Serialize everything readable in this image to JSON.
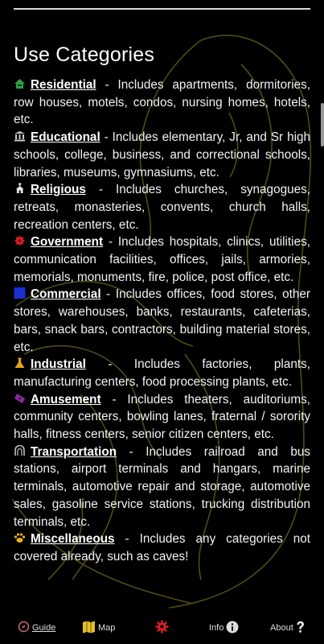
{
  "title": "Use Categories",
  "categories": [
    {
      "icon": "house-icon",
      "name": "Residential",
      "desc": " - Includes apartments, dormitories, row houses, motels, condos, nursing homes, hotels, etc."
    },
    {
      "icon": "school-building-icon",
      "name": "Educational",
      "desc": " - Includes elementary, Jr, and Sr high schools, college, business, and correctional schools, libraries, museums, gymnasiums, etc."
    },
    {
      "icon": "church-icon",
      "name": "Religious",
      "desc": " - Includes churches, synagogues, retreats, monasteries, convents, church halls, recreation centers, etc."
    },
    {
      "icon": "government-badge-icon",
      "name": "Government",
      "desc": " - Includes hospitals, clinics, utilities, communication facilities, offices, jails, armories, memorials, monuments, fire, police, post office, etc."
    },
    {
      "icon": "commercial-square-icon",
      "name": "Commercial",
      "desc": " - Includes offices, food stores, other stores, warehouses, banks, restaurants, cafeterias, bars, snack bars, contractors, building material stores, etc."
    },
    {
      "icon": "flask-icon",
      "name": "Industrial",
      "desc": " - Includes factories, plants, manufacturing centers, food processing plants, etc."
    },
    {
      "icon": "ticket-icon",
      "name": "Amusement",
      "desc": " - Includes theaters, auditoriums, community centers, bowling lanes, fraternal / sorority halls, fitness centers, senior citizen centers, etc."
    },
    {
      "icon": "tunnel-icon",
      "name": "Transportation",
      "desc": " - Includes railroad and bus stations, airport terminals and hangars, marine terminals, automotive repair and storage, automotive sales, gasoline service stations, trucking distribution terminals, etc."
    },
    {
      "icon": "paw-icon",
      "name": "Miscellaneous",
      "desc": " - Includes any categories not covered already, such as caves!"
    }
  ],
  "nav": {
    "guide": "Guide",
    "map": "Map",
    "info": "Info",
    "about": "About"
  },
  "colors": {
    "background": "#000000",
    "text": "#f2f2f2",
    "watermark": "#6b6420",
    "residential": "#2e9e44",
    "educational": "#c9c9c9",
    "religious": "#e6e6e6",
    "government": "#e02020",
    "commercial": "#1a2fd0",
    "industrial": "#e8a31c",
    "amusement": "#8a2a9e",
    "transportation": "#bdbdbd",
    "miscellaneous": "#e8b21c",
    "nav_icon_map": "#e2c02a",
    "nav_icon_settings": "#e02020"
  }
}
